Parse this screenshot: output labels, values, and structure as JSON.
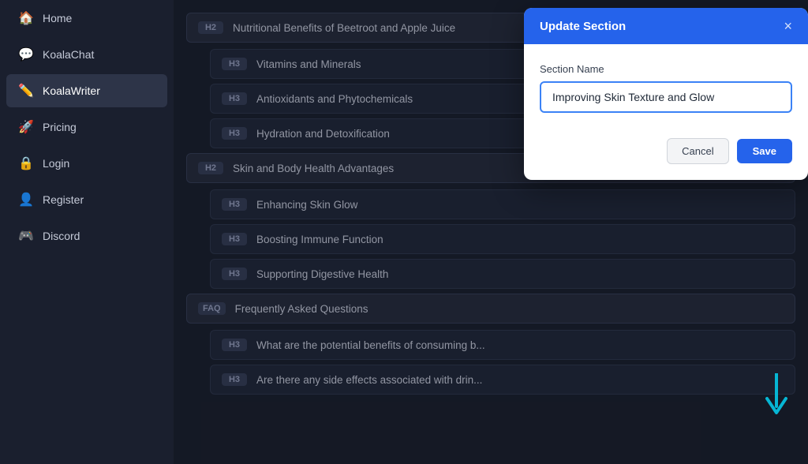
{
  "sidebar": {
    "items": [
      {
        "label": "Home",
        "icon": "🏠",
        "id": "home",
        "active": false
      },
      {
        "label": "KoalaChat",
        "icon": "💬",
        "id": "koalachat",
        "active": false
      },
      {
        "label": "KoalaWriter",
        "icon": "✏️",
        "id": "koalawriter",
        "active": true
      },
      {
        "label": "Pricing",
        "icon": "🚀",
        "id": "pricing",
        "active": false
      },
      {
        "label": "Login",
        "icon": "🔒",
        "id": "login",
        "active": false
      },
      {
        "label": "Register",
        "icon": "👤",
        "id": "register",
        "active": false
      },
      {
        "label": "Discord",
        "icon": "🎮",
        "id": "discord",
        "active": false
      }
    ]
  },
  "sections": [
    {
      "level": "H2",
      "text": "Nutritional Benefits of Beetroot and Apple Juice"
    },
    {
      "level": "H3",
      "text": "Vitamins and Minerals"
    },
    {
      "level": "H3",
      "text": "Antioxidants and Phytochemicals"
    },
    {
      "level": "H3",
      "text": "Hydration and Detoxification"
    },
    {
      "level": "H2",
      "text": "Skin and Body Health Advantages"
    },
    {
      "level": "H3",
      "text": "Enhancing Skin Glow"
    },
    {
      "level": "H3",
      "text": "Boosting Immune Function"
    },
    {
      "level": "H3",
      "text": "Supporting Digestive Health"
    },
    {
      "level": "FAQ",
      "text": "Frequently Asked Questions"
    },
    {
      "level": "H3",
      "text": "What are the potential benefits of consuming b..."
    },
    {
      "level": "H3",
      "text": "Are there any side effects associated with drin..."
    }
  ],
  "modal": {
    "title": "Update Section",
    "section_name_label": "Section Name",
    "section_name_value": "Improving Skin Texture and Glow",
    "section_name_placeholder": "Enter section name",
    "cancel_label": "Cancel",
    "save_label": "Save",
    "close_icon": "×"
  }
}
